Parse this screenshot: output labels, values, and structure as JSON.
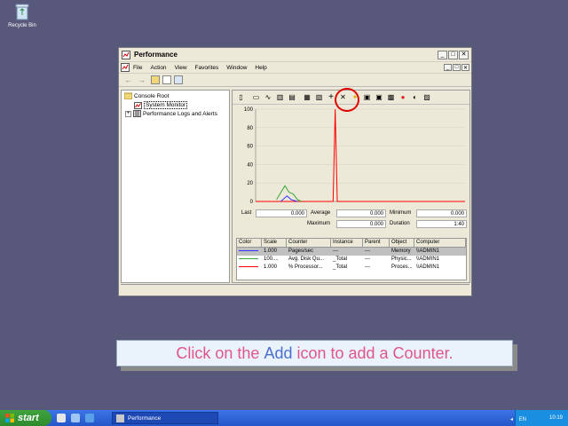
{
  "desktop": {
    "recycle_label": "Recycle Bin"
  },
  "window": {
    "title": "Performance",
    "controls": {
      "minimize": "_",
      "maximize": "□",
      "close": "✕"
    },
    "menu": [
      {
        "label": "File"
      },
      {
        "label": "Action"
      },
      {
        "label": "View"
      },
      {
        "label": "Favorites"
      },
      {
        "label": "Window"
      },
      {
        "label": "Help"
      }
    ],
    "nav": {
      "back": "←",
      "forward": "→"
    }
  },
  "tree": {
    "root": "Console Root",
    "items": [
      {
        "label": "System Monitor"
      },
      {
        "label": "Performance Logs and Alerts"
      }
    ]
  },
  "toolbar": {
    "buttons": [
      {
        "name": "new-counter-set",
        "glyph": "▯"
      },
      {
        "name": "clear-display",
        "glyph": "▭"
      },
      {
        "name": "view-current-activity",
        "glyph": "∿"
      },
      {
        "name": "view-log-data",
        "glyph": "▥"
      },
      {
        "name": "view-graph",
        "glyph": "▤"
      },
      {
        "name": "view-histogram",
        "glyph": "▦"
      },
      {
        "name": "view-report",
        "glyph": "▧"
      },
      {
        "name": "add",
        "glyph": "+"
      },
      {
        "name": "delete",
        "glyph": "✕"
      },
      {
        "name": "highlight",
        "glyph": "✦"
      },
      {
        "name": "copy-properties",
        "glyph": "▣"
      },
      {
        "name": "paste-counter-list",
        "glyph": "▣"
      },
      {
        "name": "properties",
        "glyph": "▩"
      },
      {
        "name": "freeze-display",
        "glyph": "●"
      },
      {
        "name": "update-data",
        "glyph": "◐"
      },
      {
        "name": "help",
        "glyph": "▨"
      }
    ]
  },
  "colors": {
    "red": "#ff0000",
    "green": "#3aa63a",
    "blue": "#3333ff",
    "caption_text": "#e0568a",
    "caption_highlight": "#4b6fd1"
  },
  "chart_data": {
    "type": "line",
    "ylim": [
      0,
      100
    ],
    "yticks": [
      "100",
      "80",
      "60",
      "40",
      "20",
      "0"
    ],
    "series": [
      {
        "color": "#ff0000",
        "points": [
          [
            0,
            0
          ],
          [
            0.37,
            0
          ],
          [
            0.38,
            100
          ],
          [
            0.39,
            0
          ],
          [
            1,
            0
          ]
        ]
      },
      {
        "color": "#3aa63a",
        "points": [
          [
            0.1,
            2
          ],
          [
            0.14,
            17
          ],
          [
            0.16,
            10
          ],
          [
            0.18,
            8
          ],
          [
            0.2,
            2
          ],
          [
            0.22,
            0
          ]
        ]
      },
      {
        "color": "#3333ff",
        "points": [
          [
            0.12,
            0
          ],
          [
            0.15,
            6
          ],
          [
            0.17,
            2
          ],
          [
            0.2,
            0
          ]
        ]
      }
    ]
  },
  "stats": {
    "last_label": "Last",
    "last": "0.000",
    "average_label": "Average",
    "average": "0.000",
    "minimum_label": "Minimum",
    "minimum": "0.000",
    "maximum_label": "Maximum",
    "maximum": "0.000",
    "duration_label": "Duration",
    "duration": "1:40"
  },
  "counters": {
    "headers": [
      "Color",
      "Scale",
      "Counter",
      "Instance",
      "Parent",
      "Object",
      "Computer"
    ],
    "rows": [
      {
        "color": "#3333ff",
        "scale": "1.000",
        "counter": "Pages/sec",
        "instance": "---",
        "parent": "---",
        "object": "Memory",
        "computer": "\\\\ADMIN1"
      },
      {
        "color": "#3aa63a",
        "scale": "100....",
        "counter": "Avg. Disk Qu...",
        "instance": "_Total",
        "parent": "---",
        "object": "Physic...",
        "computer": "\\\\ADMIN1"
      },
      {
        "color": "#ff0000",
        "scale": "1.000",
        "counter": "% Processor...",
        "instance": "_Total",
        "parent": "---",
        "object": "Proces...",
        "computer": "\\\\ADMIN1"
      }
    ]
  },
  "caption": {
    "before": "Click on the ",
    "highlight": "Add",
    "after": " icon to add a Counter."
  },
  "taskbar": {
    "start": "start",
    "task": "Performance",
    "lang": "EN",
    "clock": "10:19"
  }
}
